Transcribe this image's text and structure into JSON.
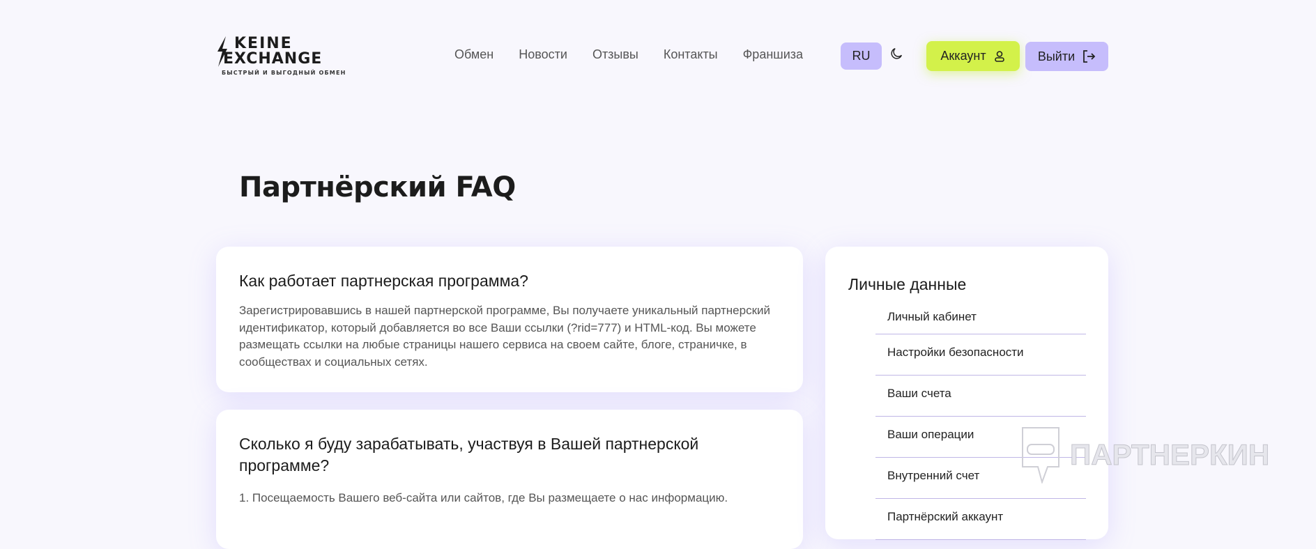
{
  "header": {
    "logo": {
      "line1": "KEINE",
      "line2": "EXCHANGE",
      "tagline": "БЫСТРЫЙ И ВЫГОДНЫЙ ОБМЕН"
    },
    "nav": [
      "Обмен",
      "Новости",
      "Отзывы",
      "Контакты",
      "Франшиза"
    ],
    "lang": "RU",
    "account_label": "Аккаунт",
    "logout_label": "Выйти",
    "colors": {
      "accent_lime": "#d3f14a",
      "accent_lavender": "#c6bdfc"
    }
  },
  "page_title": "Партнёрский FAQ",
  "faq": [
    {
      "q": "Как работает партнерская программа?",
      "a": "Зарегистрировавшись в нашей партнерской программе, Вы получаете уникальный партнерский идентификатор, который добавляется во все Ваши ссылки (?rid=777) и HTML-код. Вы можете размещать ссылки на любые страницы нашего сервиса на своем сайте, блоге, страничке, в сообществах и социальных сетях."
    },
    {
      "q": "Сколько я буду зарабатывать, участвуя в Вашей партнерской программе?",
      "a": "1. Посещаемость Вашего веб-сайта или сайтов, где Вы размещаете о нас информацию."
    }
  ],
  "sidebar": {
    "title": "Личные данные",
    "items": [
      "Личный кабинет",
      "Настройки безопасности",
      "Ваши счета",
      "Ваши операции",
      "Внутренний счет",
      "Партнёрский аккаунт"
    ]
  },
  "watermark": "ПАРТНЕРКИН"
}
